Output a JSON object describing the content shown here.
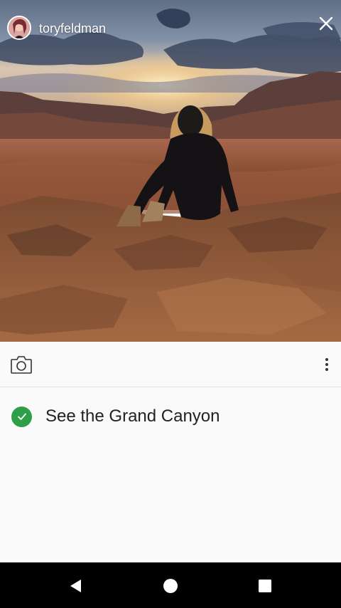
{
  "story": {
    "username": "toryfeldman",
    "close_icon": "close-icon"
  },
  "photo": {
    "subject": "person sitting on desert rock at sunset"
  },
  "toolbar": {
    "camera_icon": "camera-icon",
    "more_icon": "more-vertical-icon"
  },
  "goal": {
    "title": "See the Grand Canyon",
    "completed": true,
    "check_color": "#2e9e48"
  },
  "navbar": {
    "back_icon": "back-triangle-icon",
    "home_icon": "home-circle-icon",
    "recents_icon": "recents-square-icon"
  }
}
